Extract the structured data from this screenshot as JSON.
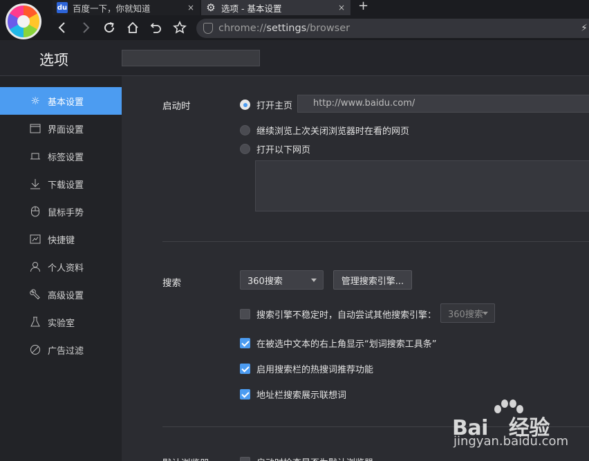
{
  "tabs": [
    {
      "title": "百度一下，你就知道",
      "favicon": "baidu-paw-icon",
      "active": false
    },
    {
      "title": "选项 - 基本设置",
      "favicon": "gear-icon",
      "active": true
    }
  ],
  "tab_close_glyph": "×",
  "new_tab_glyph": "+",
  "address": {
    "scheme": "chrome://",
    "host": "settings",
    "path": "/browser"
  },
  "settings": {
    "title": "选项",
    "search_value": ""
  },
  "sidebar": {
    "items": [
      {
        "label": "基本设置",
        "icon": "gear-icon",
        "active": true
      },
      {
        "label": "界面设置",
        "icon": "window-icon",
        "active": false
      },
      {
        "label": "标签设置",
        "icon": "tab-icon",
        "active": false
      },
      {
        "label": "下载设置",
        "icon": "download-icon",
        "active": false
      },
      {
        "label": "鼠标手势",
        "icon": "mouse-icon",
        "active": false
      },
      {
        "label": "快捷键",
        "icon": "shortcut-icon",
        "active": false
      },
      {
        "label": "个人资料",
        "icon": "user-icon",
        "active": false
      },
      {
        "label": "高级设置",
        "icon": "wrench-icon",
        "active": false
      },
      {
        "label": "实验室",
        "icon": "flask-icon",
        "active": false
      },
      {
        "label": "广告过滤",
        "icon": "block-icon",
        "active": false
      }
    ]
  },
  "startup": {
    "label": "启动时",
    "options": [
      {
        "label": "打开主页",
        "checked": true
      },
      {
        "label": "继续浏览上次关闭浏览器时在看的网页",
        "checked": false
      },
      {
        "label": "打开以下网页",
        "checked": false
      }
    ],
    "homepage_url": "http://www.baidu.com/"
  },
  "search": {
    "label": "搜索",
    "engine": "360搜索",
    "manage_button": "管理搜索引擎...",
    "fallback": {
      "label": "搜索引擎不稳定时，自动尝试其他搜索引擎：",
      "checked": false,
      "engine": "360搜索"
    },
    "options": [
      {
        "label": "在被选中文本的右上角显示“划词搜索工具条”",
        "checked": true
      },
      {
        "label": "启用搜索栏的热搜词推荐功能",
        "checked": true
      },
      {
        "label": "地址栏搜索展示联想词",
        "checked": true
      }
    ]
  },
  "default_browser": {
    "label": "默认浏览器",
    "option": "启动时检查是否为默认浏览器"
  },
  "watermark": {
    "brand": "Bai",
    "brand_suffix": "经验",
    "site": "jingyan.baidu.com"
  },
  "colors": {
    "accent": "#4c9cf1",
    "sidebar_bg": "#222327",
    "content_bg": "#2b2c31",
    "chrome_bg": "#1b1c20"
  }
}
